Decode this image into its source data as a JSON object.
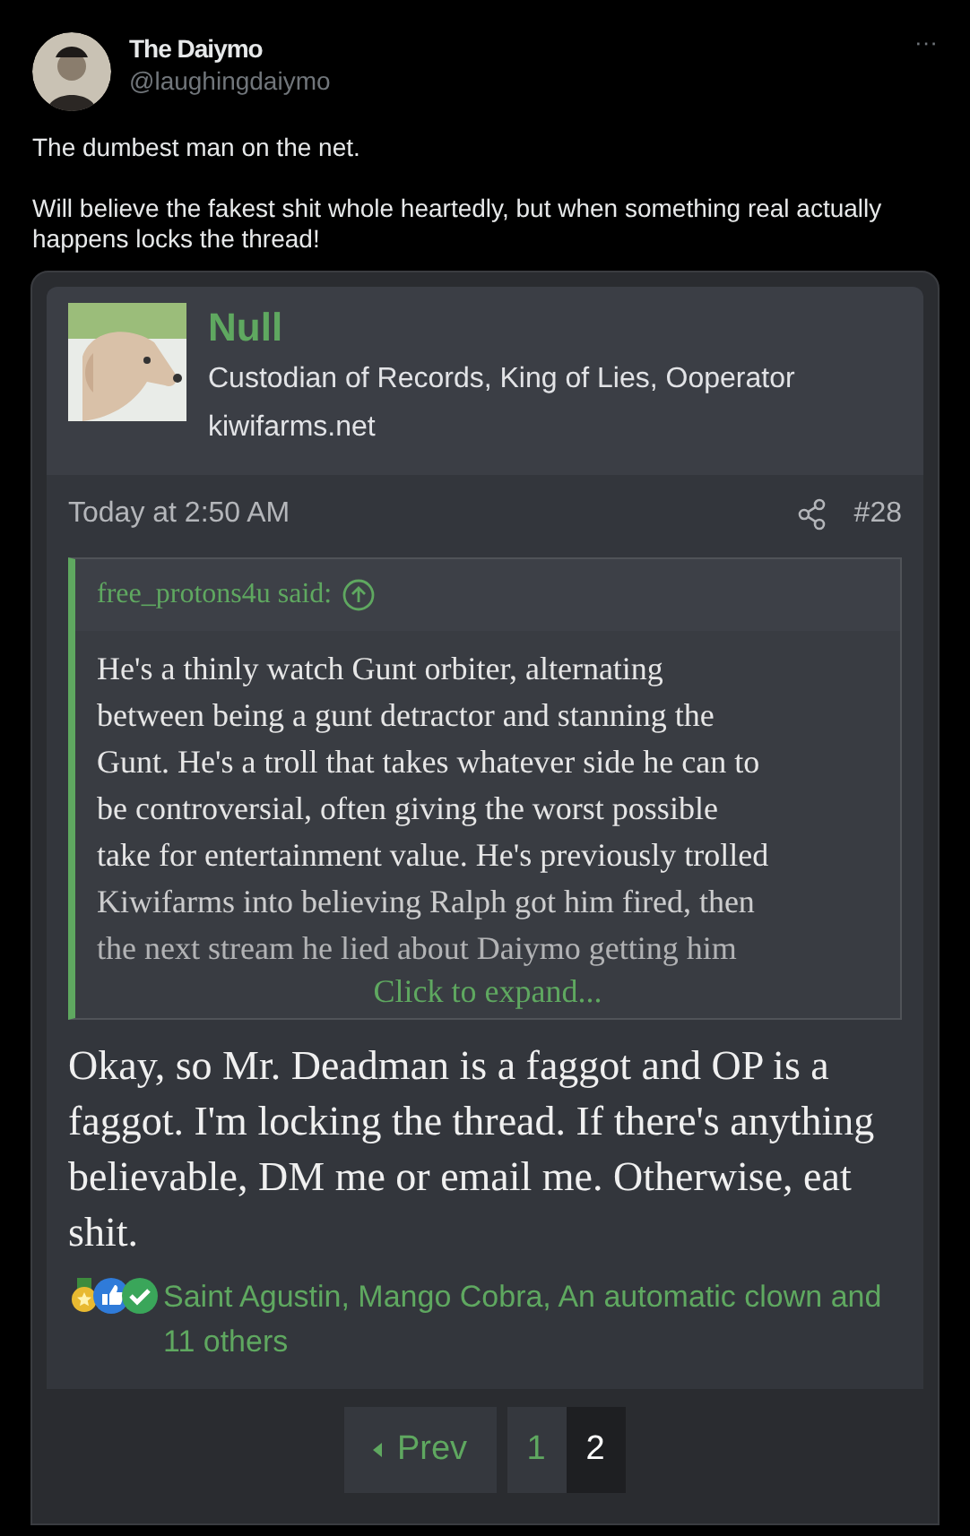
{
  "tweet": {
    "display_name": "The Daiymo",
    "handle": "@laughingdaiymo",
    "more": "···",
    "paragraphs": [
      "The dumbest man on the net.",
      "Will believe the fakest shit whole heartedly, but when something real actually happens locks the thread!"
    ]
  },
  "post": {
    "author": "Null",
    "user_title": "Custodian of Records, King of Lies, Ooperator",
    "site": "kiwifarms.net",
    "time": "Today at 2:50 AM",
    "number": "#28",
    "quote": {
      "attribution": "free_protons4u said:",
      "lines": [
        "He's a thinly watch Gunt orbiter, alternating",
        "between being a gunt detractor and stanning the",
        "Gunt. He's a troll that takes whatever side he can to",
        "be controversial, often giving the worst possible",
        "take for entertainment value. He's previously trolled",
        "Kiwifarms into believing Ralph got him fired, then",
        "the next stream he lied about Daiymo getting him"
      ],
      "expand": "Click to expand..."
    },
    "body": "Okay, so Mr. Deadman is a faggot and OP is a faggot. I'm locking the thread. If there's anything believable, DM me or email me. Otherwise, eat shit.",
    "reactions": [
      {
        "kind": "medal"
      },
      {
        "kind": "like"
      },
      {
        "kind": "check"
      }
    ],
    "reactors": "Saint Agustin, Mango Cobra, An automatic clown and 11 others"
  },
  "pagination": {
    "prev": "Prev",
    "pages": [
      {
        "label": "1",
        "selected": false
      },
      {
        "label": "2",
        "selected": true
      }
    ]
  }
}
